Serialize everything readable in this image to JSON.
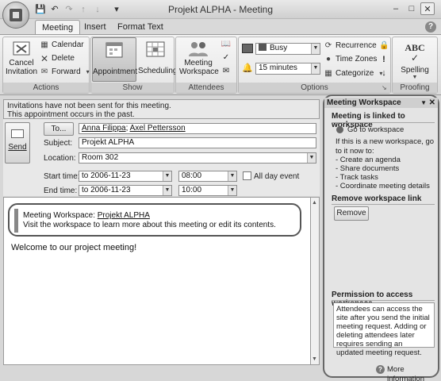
{
  "window": {
    "title": "Projekt ALPHA - Meeting"
  },
  "qat": {
    "icons": [
      "save-icon",
      "undo-icon",
      "redo-icon",
      "back-icon",
      "forward-icon",
      "customize-icon"
    ]
  },
  "ribbon": {
    "tabs": [
      {
        "label": "Meeting",
        "active": true
      },
      {
        "label": "Insert",
        "active": false
      },
      {
        "label": "Format Text",
        "active": false
      }
    ],
    "groups": {
      "actions": {
        "label": "Actions",
        "cancel_line1": "Cancel",
        "cancel_line2": "Invitation",
        "calendar": "Calendar",
        "delete": "Delete",
        "forward": "Forward"
      },
      "show": {
        "label": "Show",
        "appointment": "Appointment",
        "scheduling": "Scheduling"
      },
      "attendees": {
        "label": "Attendees",
        "meeting_line1": "Meeting",
        "meeting_line2": "Workspace"
      },
      "options": {
        "label": "Options",
        "show_as": "Busy",
        "reminder": "15 minutes",
        "recurrence": "Recurrence",
        "time_zones": "Time Zones",
        "categorize": "Categorize"
      },
      "proofing": {
        "label": "Proofing",
        "spelling": "Spelling",
        "abc": "ABC"
      }
    }
  },
  "infobar": {
    "line1": "Invitations have not been sent for this meeting.",
    "line2": "This appointment occurs in the past."
  },
  "form": {
    "send_label": "Send",
    "to_button": "To...",
    "to_value_1": "Anna Filippa",
    "to_value_sep": "; ",
    "to_value_2": "Axel Pettersson",
    "subject_label": "Subject:",
    "subject_value": "Projekt ALPHA",
    "location_label": "Location:",
    "location_value": "Room 302",
    "start_label": "Start time:",
    "start_date": "to 2006-11-23",
    "start_time": "08:00",
    "end_label": "End time:",
    "end_date": "to 2006-11-23",
    "end_time": "10:00",
    "all_day_label": "All day event",
    "all_day_checked": false
  },
  "body": {
    "workspace_prefix": "Meeting Workspace: ",
    "workspace_link": "Projekt ALPHA",
    "workspace_line2": "Visit the workspace to learn more about this meeting or edit its contents.",
    "welcome": "Welcome to our project meeting!"
  },
  "pane": {
    "title": "Meeting Workspace",
    "linked_heading": "Meeting is linked to workspace",
    "go_to": "Go to workspace",
    "intro": "If this is a new workspace, go to it now to:",
    "tasks": [
      "- Create an agenda",
      "- Share documents",
      "- Track tasks",
      "- Coordinate meeting details"
    ],
    "remove_heading": "Remove workspace link",
    "remove_button": "Remove",
    "permission_heading": "Permission to access workspace",
    "permission_text": "Attendees can access the site after you send the initial meeting request. Adding or deleting attendees later requires sending an updated meeting request.",
    "more_info": "More information"
  }
}
